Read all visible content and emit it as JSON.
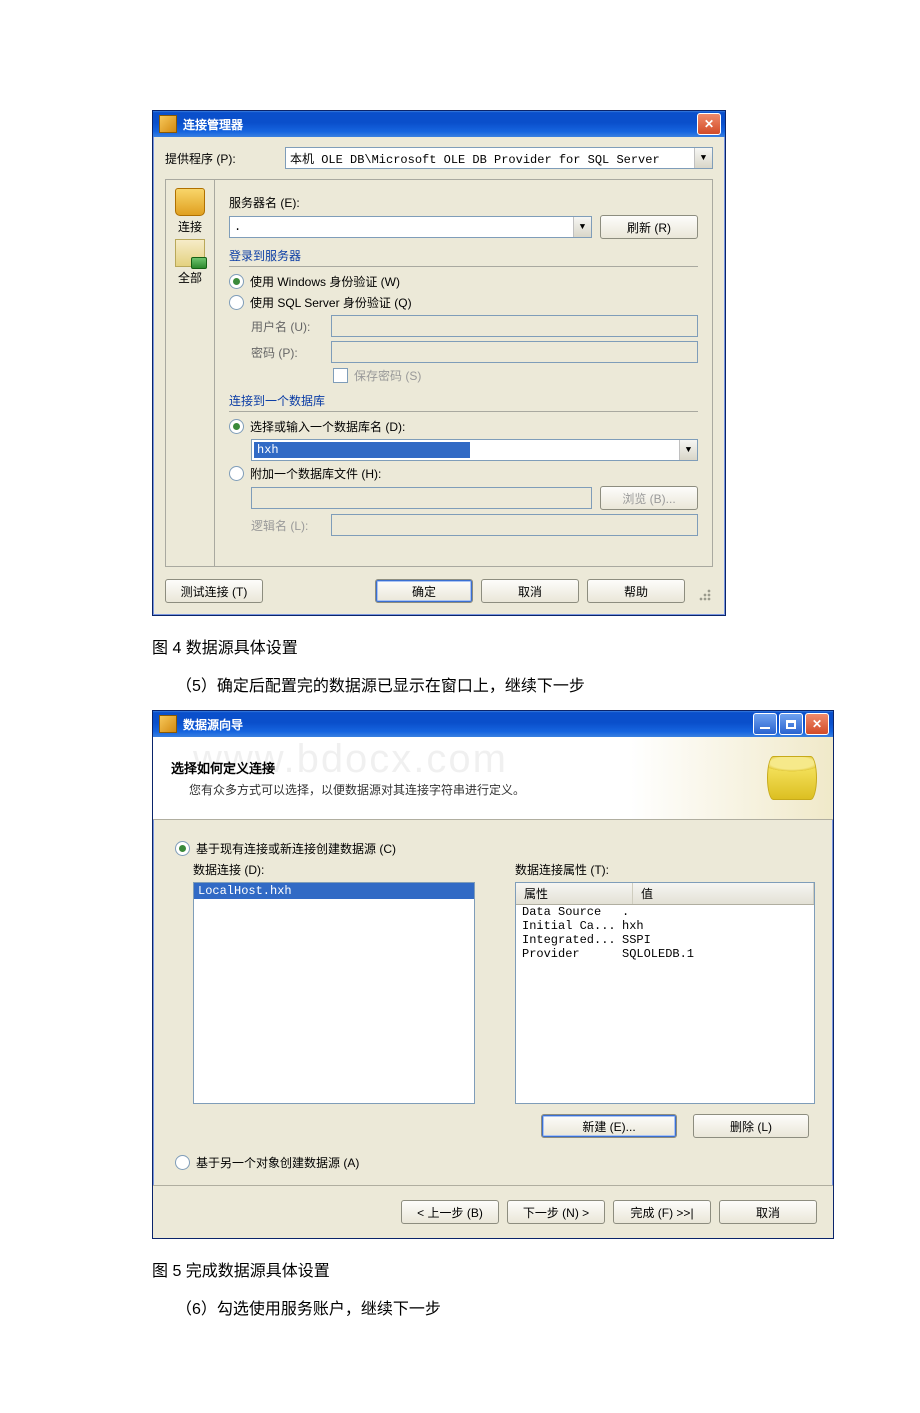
{
  "captions": {
    "fig4": "图 4 数据源具体设置",
    "step5": "（5）确定后配置完的数据源已显示在窗口上，继续下一步",
    "fig5": "图 5 完成数据源具体设置",
    "step6": "（6）勾选使用服务账户，继续下一步"
  },
  "dlg1": {
    "title": "连接管理器",
    "provider_label": "提供程序 (P):",
    "provider_value": "本机 OLE DB\\Microsoft OLE DB Provider for SQL Server",
    "tab_connect": "连接",
    "tab_all": "全部",
    "server_name_label": "服务器名 (E):",
    "server_name_value": ".",
    "refresh_btn": "刷新 (R)",
    "section_login": "登录到服务器",
    "radio_winauth": "使用 Windows 身份验证 (W)",
    "radio_sqlauth": "使用 SQL Server 身份验证 (Q)",
    "user_label": "用户名 (U):",
    "pass_label": "密码 (P):",
    "save_pass": "保存密码 (S)",
    "section_db": "连接到一个数据库",
    "radio_selectdb": "选择或输入一个数据库名 (D):",
    "db_value": "hxh",
    "radio_attach": "附加一个数据库文件 (H):",
    "browse_btn": "浏览 (B)...",
    "logical_label": "逻辑名 (L):",
    "test_btn": "测试连接 (T)",
    "ok_btn": "确定",
    "cancel_btn": "取消",
    "help_btn": "帮助"
  },
  "dlg2": {
    "title": "数据源向导",
    "watermark": "www.bdocx.com",
    "head_title": "选择如何定义连接",
    "head_sub": "您有众多方式可以选择，以便数据源对其连接字符串进行定义。",
    "radio_existing": "基于现有连接或新连接创建数据源 (C)",
    "left_label": "数据连接 (D):",
    "right_label": "数据连接属性 (T):",
    "list_item": "LocalHost.hxh",
    "prop_col": "属性",
    "val_col": "值",
    "props": [
      {
        "k": "Data Source",
        "v": "."
      },
      {
        "k": "Initial Ca...",
        "v": "hxh"
      },
      {
        "k": "Integrated...",
        "v": "SSPI"
      },
      {
        "k": "Provider",
        "v": "SQLOLEDB.1"
      }
    ],
    "new_btn": "新建 (E)...",
    "delete_btn": "删除 (L)",
    "radio_other": "基于另一个对象创建数据源 (A)",
    "back_btn": "< 上一步 (B)",
    "next_btn": "下一步 (N) >",
    "finish_btn": "完成 (F) >>|",
    "cancel_btn": "取消"
  }
}
